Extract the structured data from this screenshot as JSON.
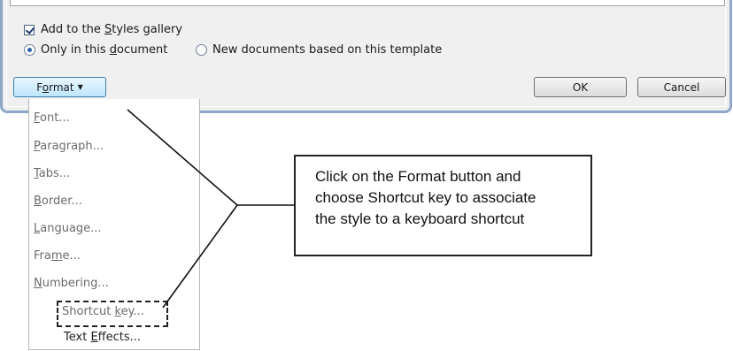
{
  "options": {
    "add_to_gallery": {
      "pre": "Add to the ",
      "key": "S",
      "post": "tyles gallery",
      "checked": true
    },
    "only_this_doc": {
      "pre": "Only in this ",
      "key": "d",
      "post": "ocument",
      "selected": true
    },
    "new_docs": {
      "label": "New documents based on this template",
      "selected": false
    }
  },
  "buttons": {
    "format": {
      "pre": "F",
      "key": "o",
      "post": "rmat"
    },
    "ok": "OK",
    "cancel": "Cancel"
  },
  "menu": {
    "items": [
      {
        "key": "F",
        "post": "ont..."
      },
      {
        "key": "P",
        "post": "aragraph..."
      },
      {
        "key": "T",
        "post": "abs..."
      },
      {
        "key": "B",
        "post": "order..."
      },
      {
        "key": "L",
        "post": "anguage..."
      },
      {
        "pre": "Fra",
        "key": "m",
        "post": "e..."
      },
      {
        "key": "N",
        "post": "umbering..."
      },
      {
        "pre": "Shortcut ",
        "key": "k",
        "post": "ey..."
      },
      {
        "pre": "Text ",
        "key": "E",
        "post": "ffects..."
      }
    ]
  },
  "callout": {
    "line1": "Click on the Format button and",
    "line2": "choose Shortcut key to associate",
    "line3": "the style to a keyboard shortcut"
  }
}
